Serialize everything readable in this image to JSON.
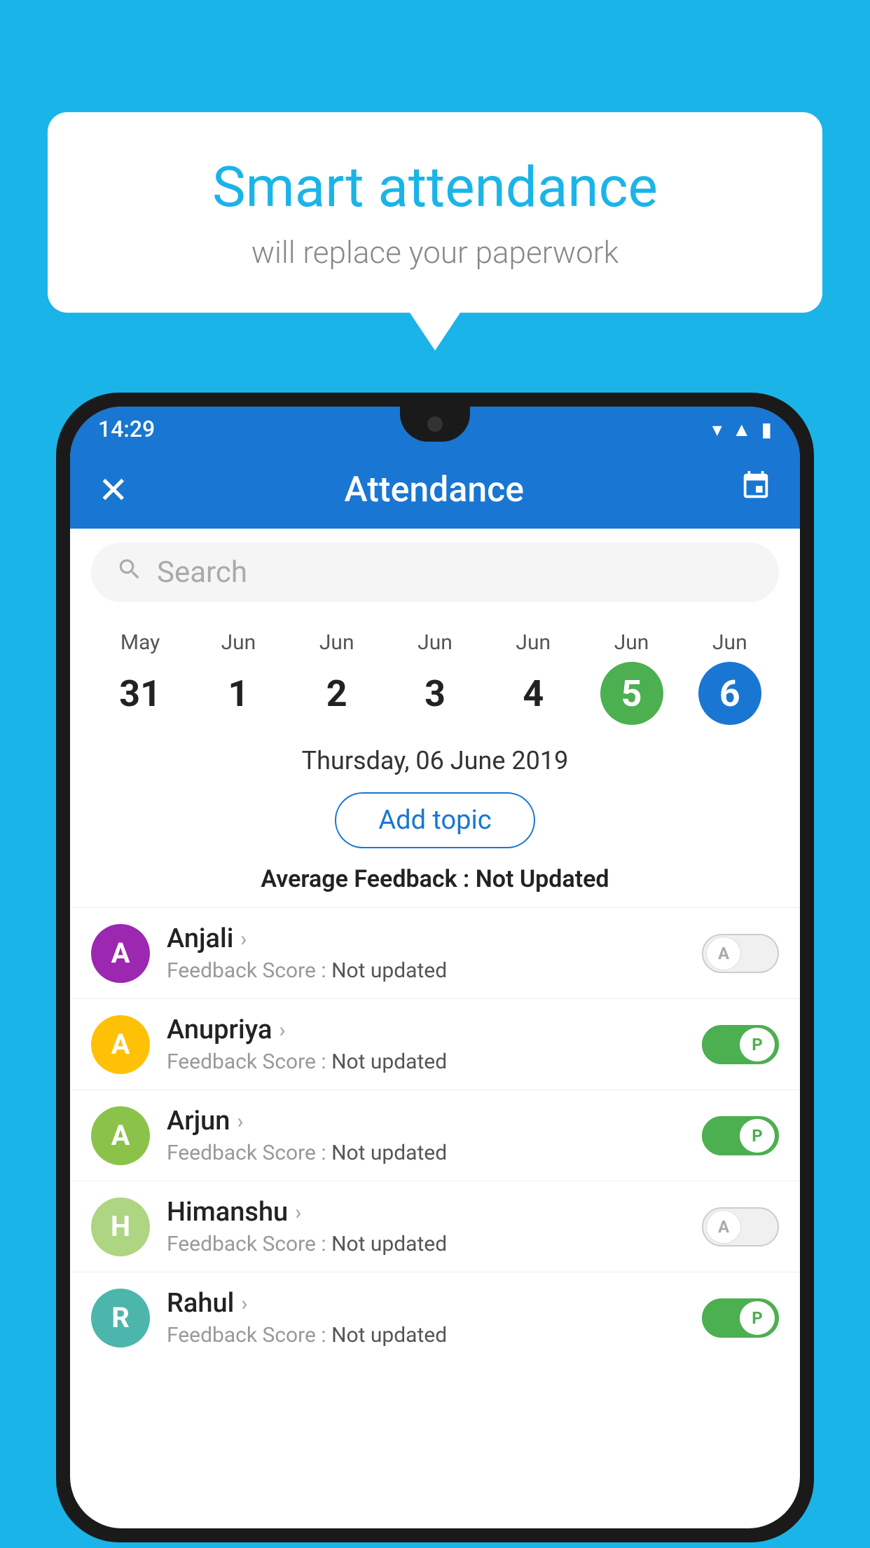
{
  "background_color": "#1ab4e8",
  "bubble": {
    "title": "Smart attendance",
    "subtitle": "will replace your paperwork"
  },
  "phone": {
    "status_bar": {
      "time": "14:29"
    },
    "app_bar": {
      "title": "Attendance",
      "close_label": "✕"
    },
    "search": {
      "placeholder": "Search"
    },
    "calendar": {
      "days": [
        {
          "month": "May",
          "date": "31",
          "state": "normal"
        },
        {
          "month": "Jun",
          "date": "1",
          "state": "normal"
        },
        {
          "month": "Jun",
          "date": "2",
          "state": "normal"
        },
        {
          "month": "Jun",
          "date": "3",
          "state": "normal"
        },
        {
          "month": "Jun",
          "date": "4",
          "state": "normal"
        },
        {
          "month": "Jun",
          "date": "5",
          "state": "today"
        },
        {
          "month": "Jun",
          "date": "6",
          "state": "selected"
        }
      ]
    },
    "selected_date": "Thursday, 06 June 2019",
    "add_topic_label": "Add topic",
    "avg_feedback_label": "Average Feedback :",
    "avg_feedback_value": "Not Updated",
    "students": [
      {
        "name": "Anjali",
        "initial": "A",
        "avatar_color": "#9c27b0",
        "feedback_label": "Feedback Score :",
        "feedback_value": "Not updated",
        "attendance": "absent"
      },
      {
        "name": "Anupriya",
        "initial": "A",
        "avatar_color": "#ffc107",
        "feedback_label": "Feedback Score :",
        "feedback_value": "Not updated",
        "attendance": "present"
      },
      {
        "name": "Arjun",
        "initial": "A",
        "avatar_color": "#8bc34a",
        "feedback_label": "Feedback Score :",
        "feedback_value": "Not updated",
        "attendance": "present"
      },
      {
        "name": "Himanshu",
        "initial": "H",
        "avatar_color": "#aed581",
        "feedback_label": "Feedback Score :",
        "feedback_value": "Not updated",
        "attendance": "absent"
      },
      {
        "name": "Rahul",
        "initial": "R",
        "avatar_color": "#4db6ac",
        "feedback_label": "Feedback Score :",
        "feedback_value": "Not updated",
        "attendance": "present"
      }
    ]
  }
}
